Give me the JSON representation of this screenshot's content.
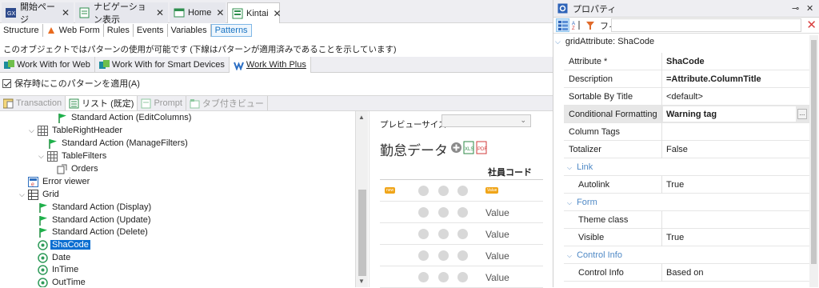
{
  "document_tabs": [
    {
      "label": "開始ページ",
      "icon": "gx-logo-icon",
      "active": false
    },
    {
      "label": "ナビゲーション表示",
      "icon": "navigation-icon",
      "active": false
    },
    {
      "label": "Home",
      "icon": "webpanel-icon",
      "active": false
    },
    {
      "label": "Kintai",
      "icon": "transaction-icon",
      "active": true
    }
  ],
  "part_tabs": [
    "Structure",
    "Web Form",
    "Rules",
    "Events",
    "Variables",
    "Patterns"
  ],
  "active_part_tab": "Patterns",
  "info_text": "このオブジェクトではパターンの使用が可能です (下線はパターンが適用済みであることを示しています)",
  "pattern_tabs": [
    "Work With for Web",
    "Work With for Smart Devices",
    "Work With Plus"
  ],
  "active_pattern_tab": "Work With Plus",
  "apply_checkbox": {
    "label": "保存時にこのパターンを適用(A)",
    "checked": true
  },
  "instance_tabs": [
    "Transaction",
    "リスト (既定)",
    "Prompt",
    "タブ付きビュー"
  ],
  "active_instance_tab": "リスト (既定)",
  "tree": [
    {
      "label": "Standard Action (EditColumns)",
      "icon": "flag-icon",
      "level": 4
    },
    {
      "label": "TableRightHeader",
      "icon": "table-icon",
      "level": 2,
      "expander": true
    },
    {
      "label": "Standard Action (ManageFilters)",
      "icon": "flag-icon",
      "level": 3
    },
    {
      "label": "TableFilters",
      "icon": "table-icon",
      "level": 3,
      "expander": true
    },
    {
      "label": "Orders",
      "icon": "orders-icon",
      "level": 4
    },
    {
      "label": "Error viewer",
      "icon": "error-viewer-icon",
      "level": 1
    },
    {
      "label": "Grid",
      "icon": "grid-icon",
      "level": 1,
      "expander": true
    },
    {
      "label": "Standard Action (Display)",
      "icon": "flag-icon",
      "level": 2
    },
    {
      "label": "Standard Action (Update)",
      "icon": "flag-icon",
      "level": 2
    },
    {
      "label": "Standard Action (Delete)",
      "icon": "flag-icon",
      "level": 2
    },
    {
      "label": "ShaCode",
      "icon": "attribute-icon",
      "level": 2,
      "selected": true
    },
    {
      "label": "Date",
      "icon": "attribute-icon",
      "level": 2
    },
    {
      "label": "InTime",
      "icon": "attribute-icon",
      "level": 2
    },
    {
      "label": "OutTime",
      "icon": "attribute-icon",
      "level": 2
    }
  ],
  "preview": {
    "size_label": "プレビューサイズ",
    "title": "勤怠データ",
    "column_header": "社員コード",
    "first_row_tag": "new",
    "first_row_value_tag": "Value",
    "rows": [
      "Value",
      "Value",
      "Value",
      "Value"
    ]
  },
  "properties": {
    "title": "プロパティ",
    "filter_label": "フィルタ",
    "object_header": "gridAttribute: ShaCode",
    "rows": [
      {
        "key": "Attribute *",
        "value": "ShaCode",
        "bold": true
      },
      {
        "key": "Description",
        "value": "=Attribute.ColumnTitle",
        "bold": true
      },
      {
        "key": "Sortable By Title",
        "value": "<default>",
        "bold": false
      },
      {
        "key": "Conditional Formatting",
        "value": "Warning tag",
        "bold": true,
        "highlighted": true,
        "ellipsis": "..."
      },
      {
        "key": "Column Tags",
        "value": "",
        "bold": false
      },
      {
        "key": "Totalizer",
        "value": "False",
        "bold": false
      }
    ],
    "sections": [
      {
        "name": "Link",
        "rows": [
          {
            "key": "Autolink",
            "value": "True"
          }
        ]
      },
      {
        "name": "Form",
        "rows": [
          {
            "key": "Theme class",
            "value": ""
          },
          {
            "key": "Visible",
            "value": "True"
          }
        ]
      },
      {
        "name": "Control Info",
        "rows": [
          {
            "key": "Control Info",
            "value": "Based on"
          }
        ]
      }
    ]
  },
  "colors": {
    "accent": "#0a6ed1",
    "section": "#4f89c6",
    "tag": "#f0a519"
  }
}
